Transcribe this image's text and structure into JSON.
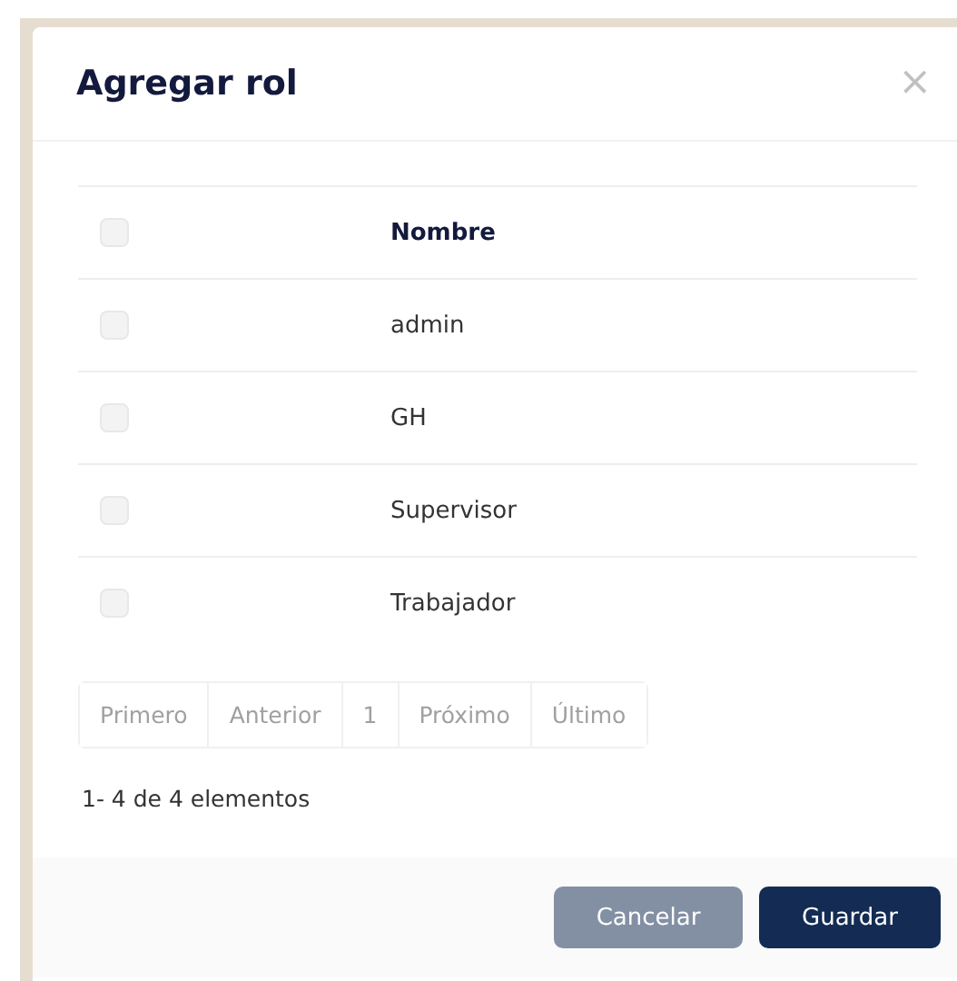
{
  "dialog": {
    "title": "Agregar rol",
    "close_label": "×"
  },
  "table": {
    "header": {
      "checked": false,
      "label": "Nombre"
    },
    "rows": [
      {
        "name": "admin",
        "checked": false
      },
      {
        "name": "GH",
        "checked": false
      },
      {
        "name": "Supervisor",
        "checked": false
      },
      {
        "name": "Trabajador",
        "checked": false
      }
    ]
  },
  "pagination": {
    "buttons": [
      {
        "label": "Primero",
        "selected": false
      },
      {
        "label": "Anterior",
        "selected": false
      },
      {
        "label": "1",
        "selected": false
      },
      {
        "label": "Próximo",
        "selected": false
      },
      {
        "label": "Último",
        "selected": false
      }
    ],
    "summary": "1- 4 de 4 elementos"
  },
  "buttons": [
    {
      "label": "Cancelar",
      "kind": "secondary"
    },
    {
      "label": "Guardar",
      "kind": "primary"
    }
  ]
}
